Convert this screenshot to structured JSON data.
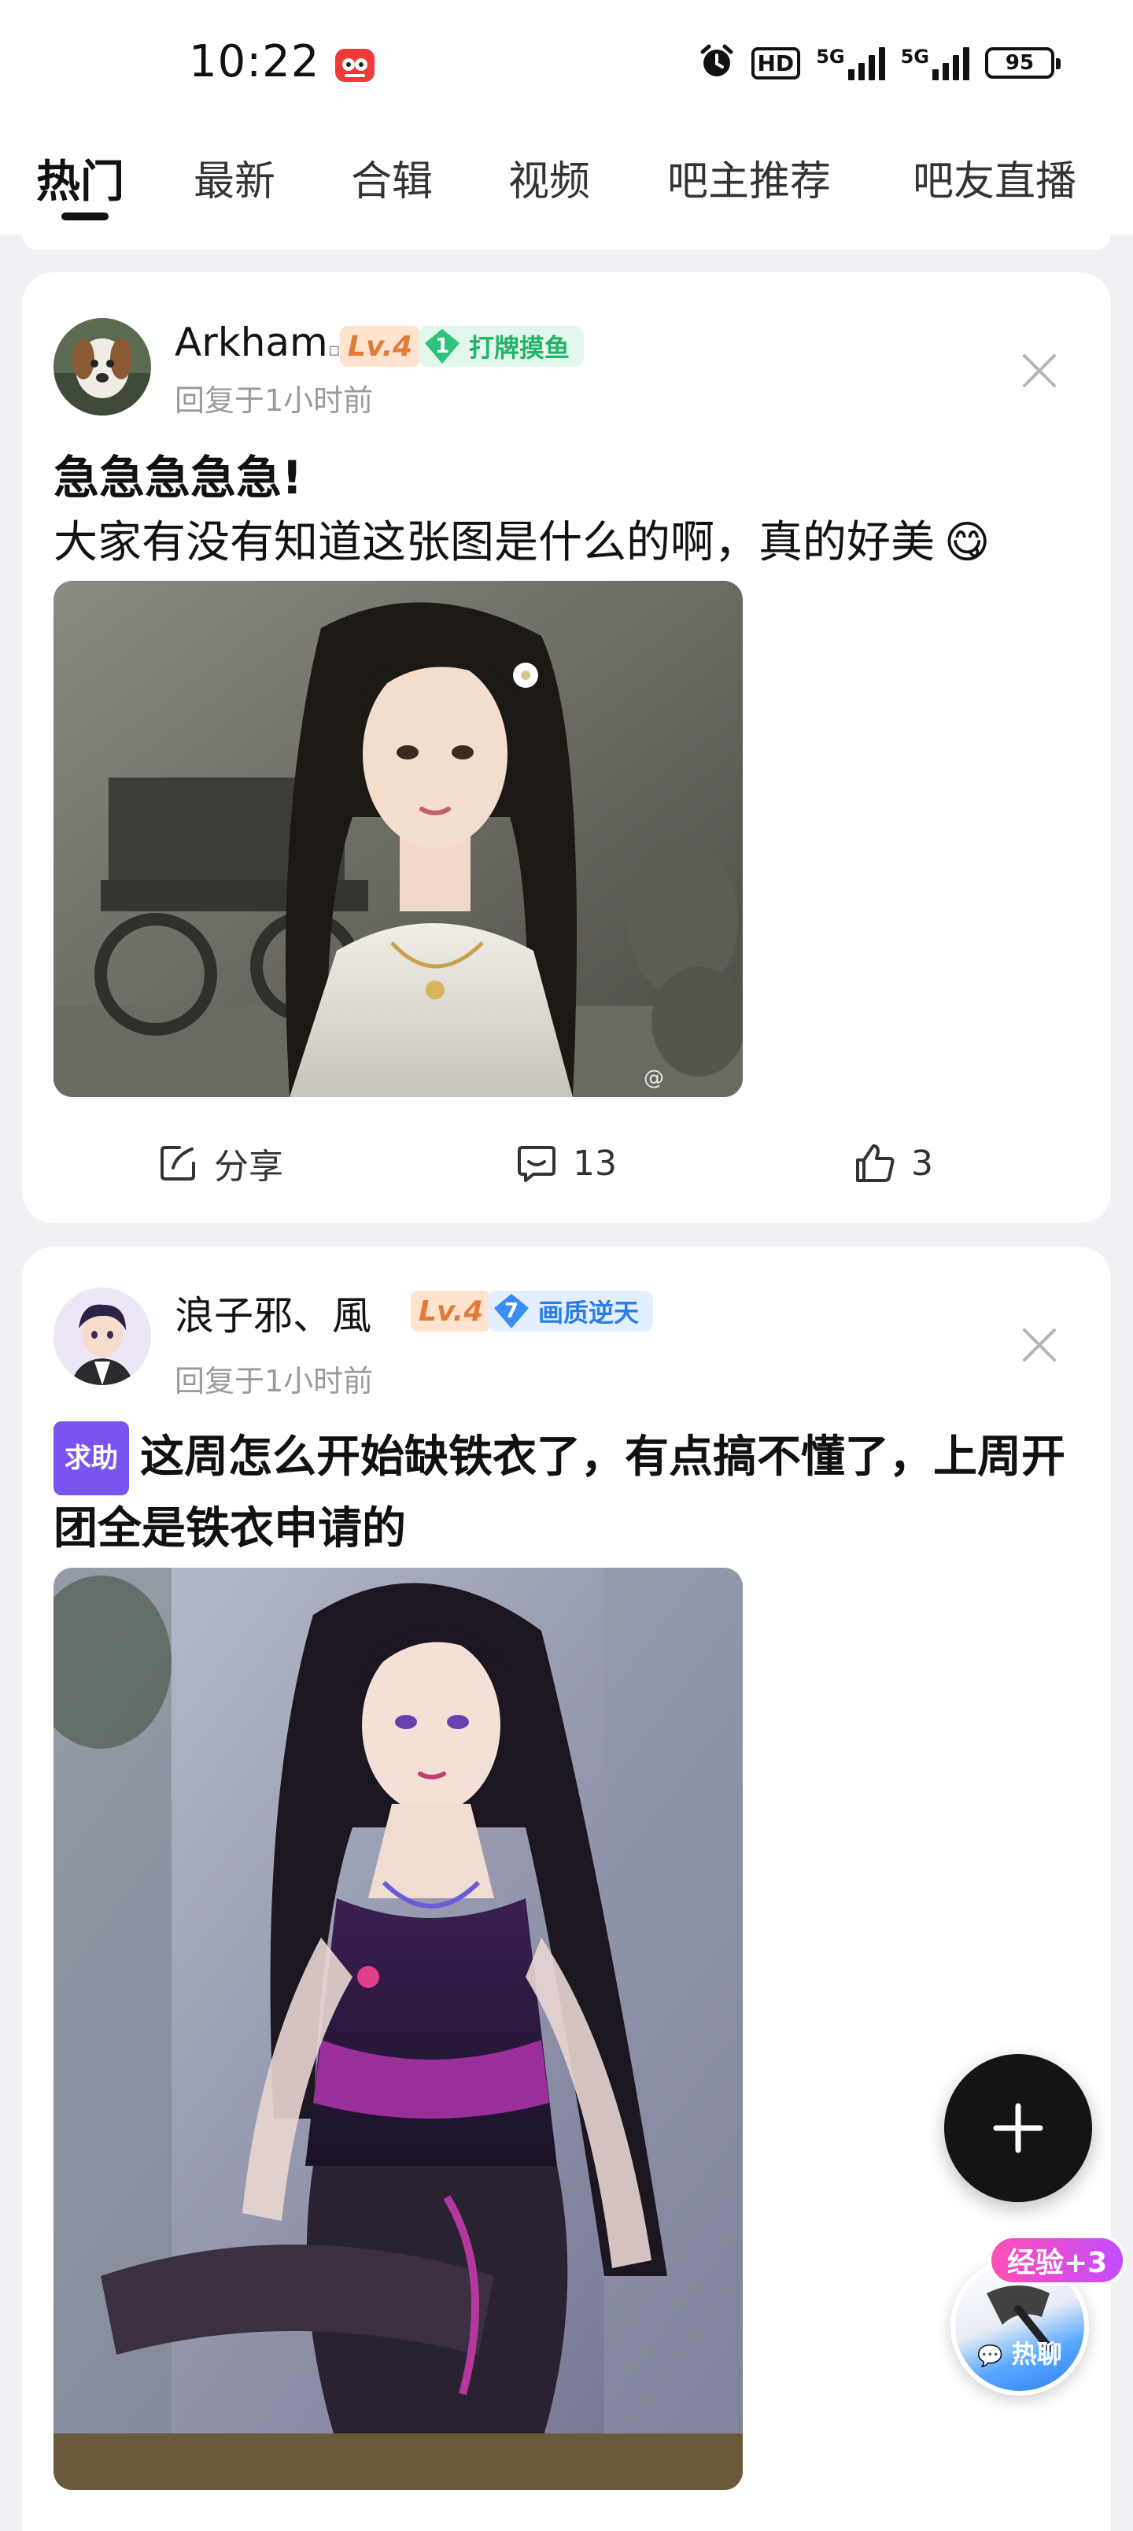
{
  "status_bar": {
    "time": "10:22",
    "hd_label": "HD",
    "net1": "5G",
    "net2": "5G",
    "battery": "95",
    "icons": [
      "app-badge-icon",
      "alarm-icon",
      "hd-icon",
      "signal-icon",
      "battery-icon"
    ]
  },
  "tabs": [
    {
      "label": "热门",
      "active": true
    },
    {
      "label": "最新",
      "active": false
    },
    {
      "label": "合辑",
      "active": false
    },
    {
      "label": "视频",
      "active": false
    },
    {
      "label": "吧主推荐",
      "active": false
    },
    {
      "label": "吧友直播",
      "active": false
    }
  ],
  "posts": [
    {
      "username": "Arkham",
      "level": "Lv.4",
      "badge_num": "1",
      "badge_text": "打牌摸鱼",
      "meta": "回复于1小时前",
      "title": "急急急急急!",
      "body": "大家有没有知道这张图是什么的啊，真的好美",
      "emoji": "😋",
      "actions": {
        "share": "分享",
        "comments": "13",
        "likes": "3"
      }
    },
    {
      "username": "浪子邪、風",
      "level": "Lv.4",
      "badge_num": "7",
      "badge_text": "画质逆天",
      "meta": "回复于1小时前",
      "tag": "求助",
      "title": "这周怎么开始缺铁衣了，有点搞不懂了，上周开团全是铁衣申请的"
    }
  ],
  "floating": {
    "exp_badge": "经验+3",
    "hot_chat": "热聊"
  },
  "colors": {
    "accent_green": "#23b46a",
    "accent_blue": "#2a7de6",
    "level_orange": "#e27a3a",
    "tag_purple": "#7a54f0"
  }
}
